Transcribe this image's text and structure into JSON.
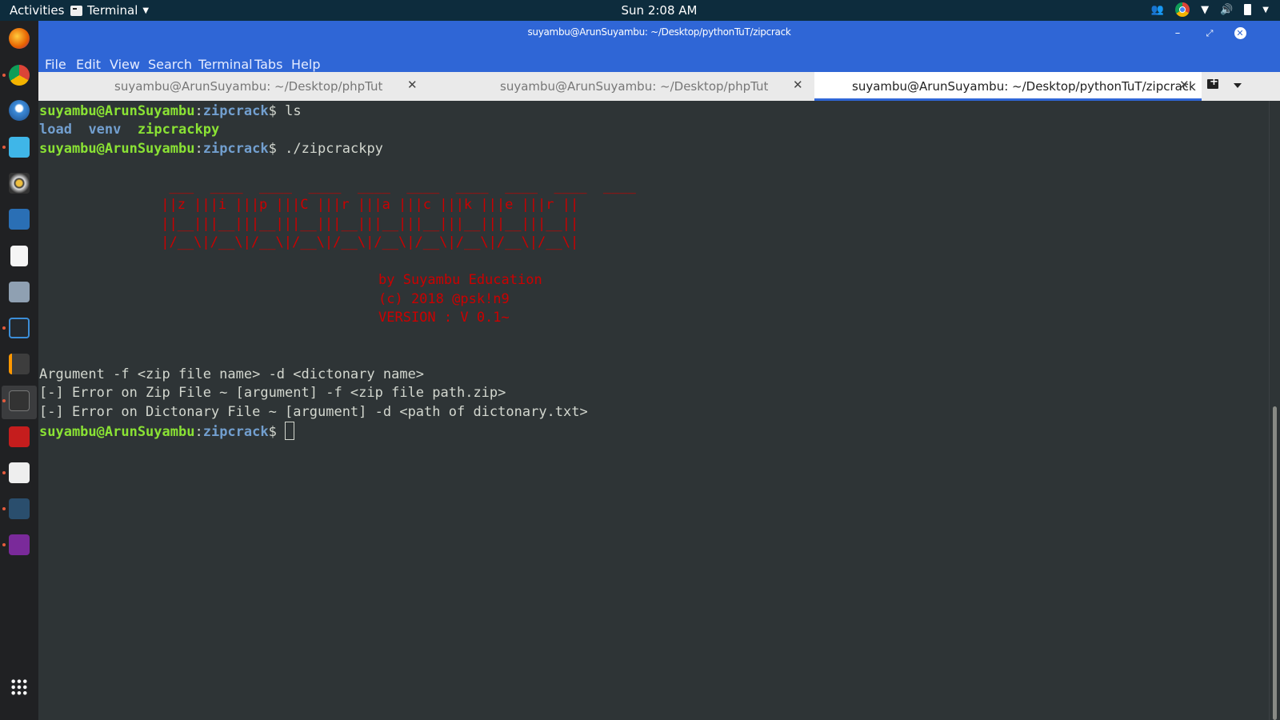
{
  "topbar": {
    "activities": "Activities",
    "app_name": "Terminal",
    "clock": "Sun  2:08 AM"
  },
  "window": {
    "title": "suyambu@ArunSuyambu: ~/Desktop/pythonTuT/zipcrack"
  },
  "menu": [
    "File",
    "Edit",
    "View",
    "Search",
    "Terminal",
    "Tabs",
    "Help"
  ],
  "tabs": [
    {
      "label": "suyambu@ArunSuyambu: ~/Desktop/phpTut",
      "active": false
    },
    {
      "label": "suyambu@ArunSuyambu: ~/Desktop/phpTut",
      "active": false
    },
    {
      "label": "suyambu@ArunSuyambu: ~/Desktop/pythonTuT/zipcrack",
      "active": true
    }
  ],
  "terminal": {
    "prompt_user": "suyambu@ArunSuyambu",
    "prompt_path": "zipcrack",
    "prompt_sym": "$ ",
    "cmd1": "ls",
    "ls_items": [
      "load",
      "venv",
      "zipcrackpy"
    ],
    "cmd2": "./zipcrackpy",
    "banner": [
      "  ___  ____  ____  ____  ____  ____  ____  ____  ____  ____",
      " ||z |||i |||p |||C |||r |||a |||c |||k |||e |||r ||",
      " ||__|||__|||__|||__|||__|||__|||__|||__|||__|||__||",
      " |/__\\|/__\\|/__\\|/__\\|/__\\|/__\\|/__\\|/__\\|/__\\|/__\\|"
    ],
    "credits": [
      "by Suyambu Education",
      "(c) 2018 @psk!n9",
      "VERSION : V 0.1~"
    ],
    "output": [
      "Argument -f <zip file name> -d <dictonary name>",
      "[-] Error on Zip File ~ [argument] -f <zip file path.zip>",
      "[-] Error on Dictonary File ~ [argument] -d <path of dictonary.txt>"
    ]
  },
  "colors": {
    "accent": "#2f66d6",
    "terminal_bg": "#2e3436",
    "prompt_green": "#8ae234",
    "prompt_blue": "#729fcf",
    "banner_red": "#cc0000"
  }
}
